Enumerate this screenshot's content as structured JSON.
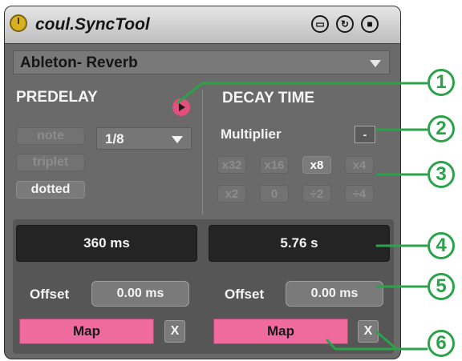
{
  "device": {
    "title": "coul.SyncTool",
    "header_icons": [
      "minimize-icon",
      "hotswap-icon",
      "save-preset-icon"
    ],
    "target_device": "Ableton- Reverb"
  },
  "predelay": {
    "heading": "PREDELAY",
    "note_label": "note",
    "triplet_label": "triplet",
    "dotted_label": "dotted",
    "active_mode": "dotted",
    "division": "1/8",
    "readout": "360 ms",
    "offset_label": "Offset",
    "offset_value": "0.00 ms",
    "map_label": "Map",
    "clear_label": "X"
  },
  "decay": {
    "heading": "DECAY TIME",
    "multiplier_label": "Multiplier",
    "reset_label": "-",
    "multipliers_row1": [
      "x32",
      "x16",
      "x8",
      "x4"
    ],
    "multipliers_row2": [
      "x2",
      "0",
      "÷2",
      "÷4"
    ],
    "active_multiplier": "x8",
    "readout": "5.76 s",
    "offset_label": "Offset",
    "offset_value": "0.00 ms",
    "map_label": "Map",
    "clear_label": "X"
  },
  "callouts": [
    "1",
    "2",
    "3",
    "4",
    "5",
    "6"
  ],
  "colors": {
    "accent": "#f06b9d",
    "callout": "#2aa34a",
    "panel": "#6a6a6a",
    "readout_bg": "#242424"
  }
}
